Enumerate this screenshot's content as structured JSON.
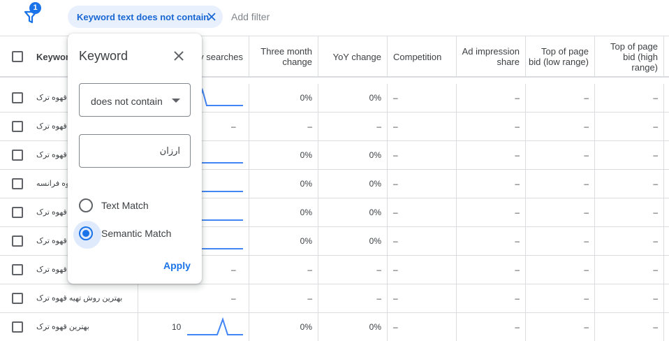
{
  "filter_bar": {
    "filter_count": "1",
    "chip_label": "Keyword text does not contain",
    "add_filter": "Add filter"
  },
  "popup": {
    "title": "Keyword",
    "operator": "does not contain",
    "value": "ارزان",
    "options": [
      {
        "label": "Text Match",
        "selected": false
      },
      {
        "label": "Semantic Match",
        "selected": true
      }
    ],
    "apply_label": "Apply"
  },
  "columns": [
    {
      "label": "Keyword"
    },
    {
      "label": "Avg. monthly searches",
      "visible_label": "ly searches"
    },
    {
      "label": "Three month change"
    },
    {
      "label": "YoY change"
    },
    {
      "label": "Competition"
    },
    {
      "label": "Ad impression share"
    },
    {
      "label": "Top of page bid (low range)"
    },
    {
      "label": "Top of page bid (high range)"
    }
  ],
  "header_labels": {
    "keyword": "Keywor",
    "searches": "ly searches",
    "three_month_1": "Three month",
    "three_month_2": "change",
    "yoy": "YoY change",
    "competition": "Competition",
    "impression_1": "Ad impression",
    "impression_2": "share",
    "bid_low_1": "Top of page",
    "bid_low_2": "bid (low range)",
    "bid_high_1": "Top of page",
    "bid_high_2": "bid (high",
    "bid_high_3": "range)"
  },
  "rows": [
    {
      "keyword": "قهوه ترک",
      "searches": "",
      "trend": "spike",
      "three_month": "0%",
      "yoy": "0%",
      "competition": "–",
      "impression": "–",
      "bid_low": "–",
      "bid_high": "–"
    },
    {
      "keyword": "قهوه ترک",
      "searches": "–",
      "trend": "none",
      "three_month": "–",
      "yoy": "–",
      "competition": "–",
      "impression": "–",
      "bid_low": "–",
      "bid_high": "–"
    },
    {
      "keyword": "ع قهوه ترک",
      "searches": "",
      "trend": "flat",
      "three_month": "0%",
      "yoy": "0%",
      "competition": "–",
      "impression": "–",
      "bid_low": "–",
      "bid_high": "–"
    },
    {
      "keyword": "قهوه فرانسه",
      "searches": "",
      "trend": "flat",
      "three_month": "0%",
      "yoy": "0%",
      "competition": "–",
      "impression": "–",
      "bid_low": "–",
      "bid_high": "–"
    },
    {
      "keyword": "ن قهوه ترک",
      "searches": "",
      "trend": "flat",
      "three_month": "0%",
      "yoy": "0%",
      "competition": "–",
      "impression": "–",
      "bid_low": "–",
      "bid_high": "–"
    },
    {
      "keyword": "ن قهوه ترک",
      "searches": "",
      "trend": "flat",
      "three_month": "0%",
      "yoy": "0%",
      "competition": "–",
      "impression": "–",
      "bid_low": "–",
      "bid_high": "–"
    },
    {
      "keyword": "د قهوه ترک",
      "searches": "–",
      "trend": "none",
      "three_month": "–",
      "yoy": "–",
      "competition": "–",
      "impression": "–",
      "bid_low": "–",
      "bid_high": "–"
    },
    {
      "keyword": "بهترین روش تهیه قهوه ترک",
      "searches": "–",
      "trend": "none",
      "three_month": "–",
      "yoy": "–",
      "competition": "–",
      "impression": "–",
      "bid_low": "–",
      "bid_high": "–"
    },
    {
      "keyword": "بهترین قهوه ترک",
      "searches": "10",
      "trend": "spike-single",
      "three_month": "0%",
      "yoy": "0%",
      "competition": "–",
      "impression": "–",
      "bid_low": "–",
      "bid_high": "–"
    }
  ],
  "colors": {
    "accent": "#1a73e8",
    "chip_bg": "#e8f0fe",
    "chip_text": "#1967d2",
    "border": "#dadce0",
    "text": "#3c4043",
    "sparkline": "#4285f4"
  }
}
